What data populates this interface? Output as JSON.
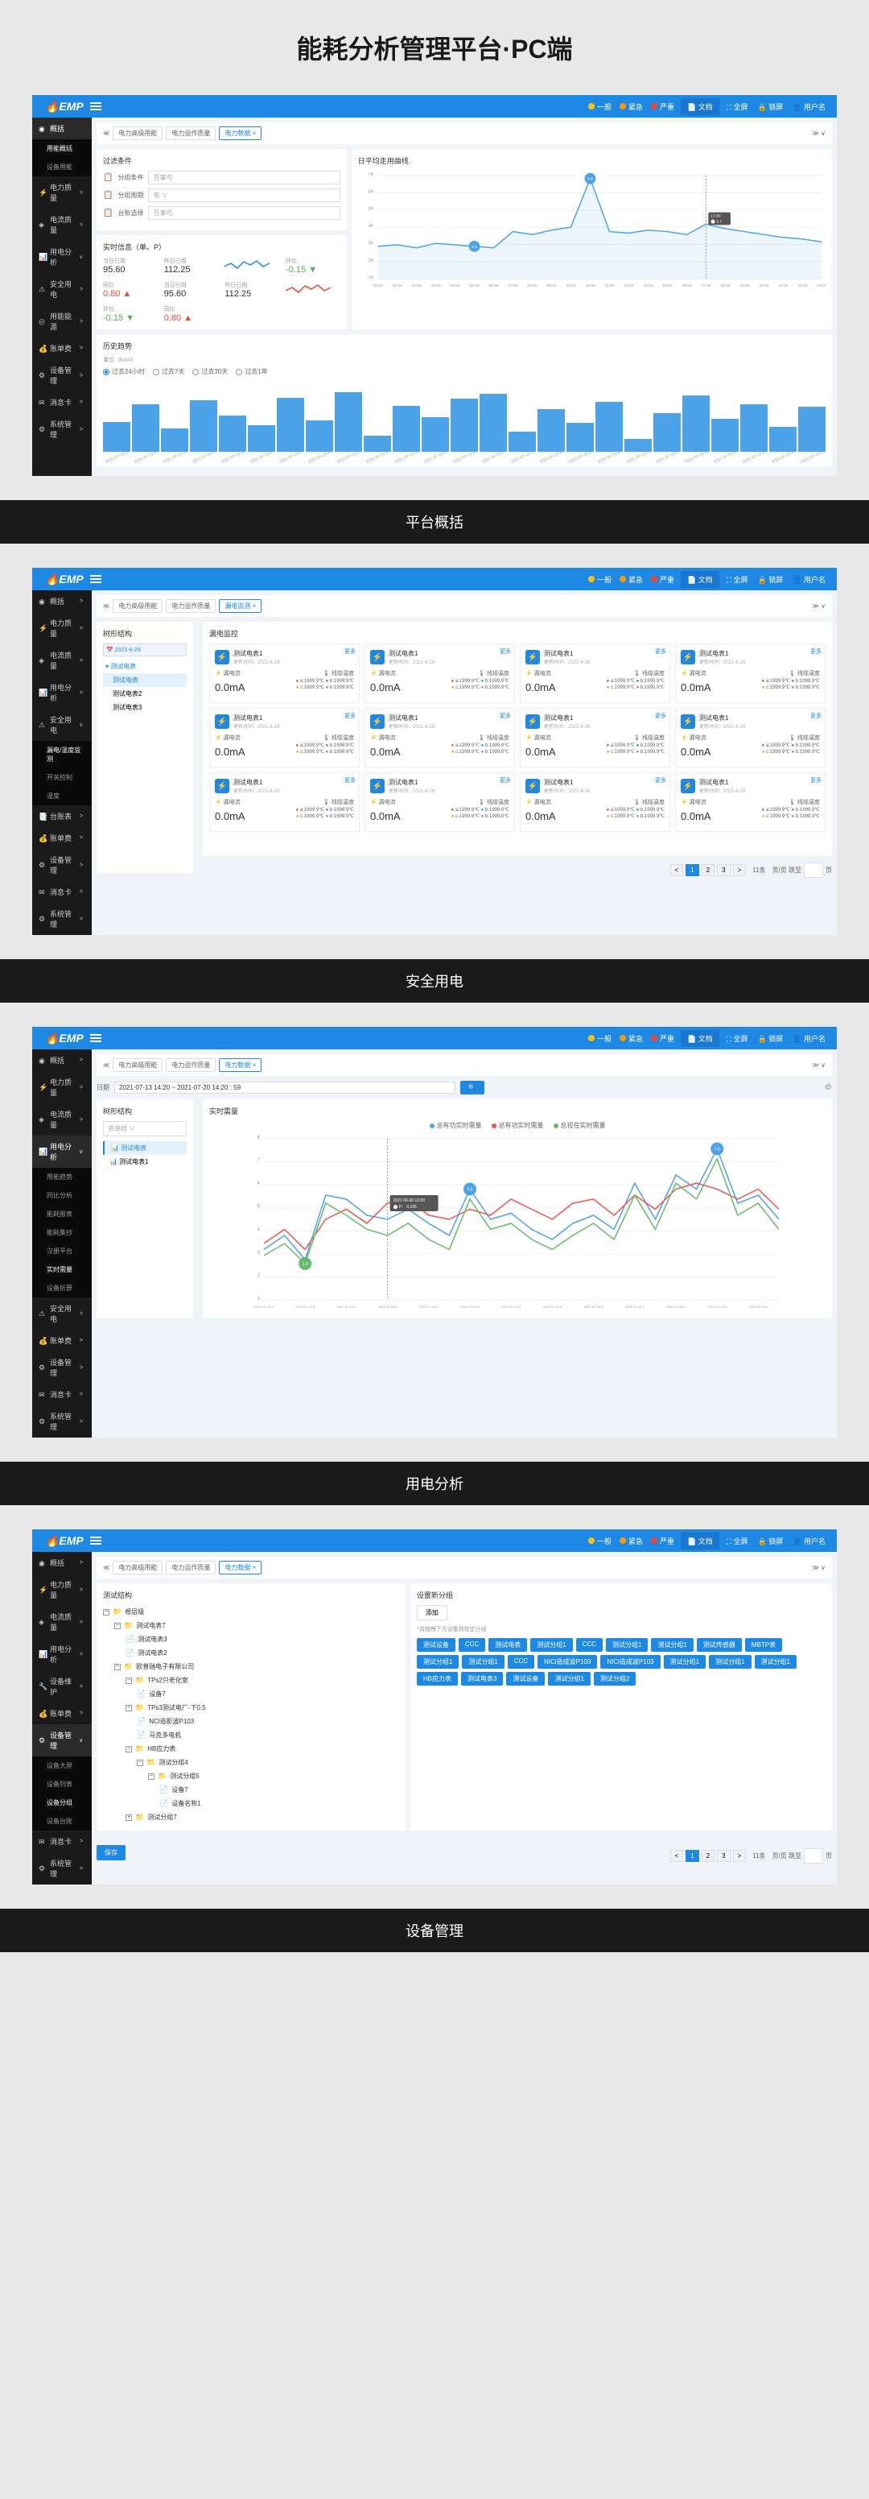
{
  "page_title": "能耗分析管理平台·PC端",
  "logo": "EMP",
  "top_badges": [
    {
      "label": "一般",
      "color": "#ffc107"
    },
    {
      "label": "紧急",
      "color": "#ff9800"
    },
    {
      "label": "严重",
      "color": "#f44336"
    }
  ],
  "top_actions": {
    "doc": "文档",
    "fullscreen": "全屏",
    "lock": "锁屏",
    "user": "用户名"
  },
  "captions": [
    "平台概括",
    "安全用电",
    "用电分析",
    "设备管理"
  ],
  "s1": {
    "sidebar": [
      {
        "label": "概括",
        "icon": "◉",
        "active": true
      },
      {
        "sub": "用能概括",
        "active": true
      },
      {
        "sub": "设备用能"
      },
      {
        "label": "电力质量",
        "icon": "⚡",
        "chev": ">"
      },
      {
        "label": "电流质量",
        "icon": "◈",
        "chev": ">"
      },
      {
        "label": "用电分析",
        "icon": "📊",
        "chev": "v"
      },
      {
        "label": "安全用电",
        "icon": "⚠",
        "chev": ">"
      },
      {
        "label": "用能能源",
        "icon": "◎",
        "chev": ">"
      },
      {
        "label": "账单费",
        "icon": "💰",
        "chev": ">"
      },
      {
        "label": "设备管理",
        "icon": "⚙",
        "chev": ">"
      },
      {
        "label": "消息卡",
        "icon": "✉",
        "chev": ">"
      },
      {
        "label": "系统管理",
        "icon": "⚙",
        "chev": ">"
      }
    ],
    "breadcrumb": {
      "items": [
        "电力高级用能",
        "电力运作质量"
      ],
      "active": "电力数据 ×"
    },
    "filter": {
      "title": "过滤条件",
      "rows": [
        {
          "icon": "📋",
          "label": "分组条件",
          "ph": "百事可"
        },
        {
          "icon": "📋",
          "label": "分组周期",
          "ph": "电",
          "suffix": "∨"
        },
        {
          "icon": "📋",
          "label": "台账选择",
          "ph": "百事可"
        }
      ]
    },
    "realtime": {
      "title": "实时信息（单。P）",
      "stats": [
        {
          "label": "当日已用",
          "value": "95.60"
        },
        {
          "label": "昨日已用",
          "value": "112.25",
          "spark": "blue"
        },
        {
          "label": "环比",
          "value": "-0.15",
          "color": "#4caf50"
        },
        {
          "label": "同比",
          "value": "0.80",
          "color": "#f44336"
        },
        {
          "label": "当日已用",
          "value": "95.60"
        },
        {
          "label": "昨日已用",
          "value": "112.25",
          "spark": "red"
        },
        {
          "label": "环比",
          "value": "-0.15",
          "color": "#4caf50"
        },
        {
          "label": "同比",
          "value": "0.80",
          "color": "#f44336"
        }
      ]
    },
    "chart_data": {
      "line": {
        "type": "line",
        "title": "日平均走用曲线",
        "ylabels": [
          "7K",
          "6K",
          "5K",
          "4K",
          "3K",
          "2K",
          "1K"
        ],
        "x": [
          "00:00",
          "01:00",
          "02:00",
          "03:00",
          "04:00",
          "05:00",
          "06:00",
          "07:00",
          "08:00",
          "09:00",
          "10:00",
          "11:00",
          "12:00",
          "13:00",
          "14:00",
          "15:00",
          "16:00",
          "17:00",
          "18:00",
          "19:00",
          "20:00",
          "21:00",
          "22:00",
          "23:00"
        ],
        "values": [
          2.2,
          2.3,
          2.1,
          2.4,
          2.3,
          2.2,
          2.1,
          3.2,
          3.0,
          3.3,
          3.5,
          6.8,
          3.2,
          3.1,
          3.3,
          3.2,
          3.0,
          3.7,
          3.4,
          3.2,
          3.0,
          2.8,
          2.7,
          2.5
        ],
        "marker1": {
          "idx": 5,
          "val": "2.2"
        },
        "marker2": {
          "idx": 11,
          "val": "6.8"
        },
        "tooltip": {
          "idx": 17,
          "time": "17:30",
          "val": "3.7"
        }
      },
      "bars": {
        "type": "bar",
        "title": "历史趋势",
        "unit": "单位（Kw=）",
        "radios": [
          "过去24小时",
          "过去7天",
          "过去30天",
          "过去1年"
        ],
        "radio_active": 0,
        "x": [
          "2021-07-15 #",
          "2021-07-15 #",
          "2021-07-15 #",
          "2021-07-15 #",
          "2021-07-15 #",
          "2021-07-15 #",
          "2021-07-15 #",
          "2021-07-15 #",
          "2021-07-15 #",
          "2021-07-15 #",
          "2021-07-15 #",
          "2021-07-15 #",
          "2021-07-15 #",
          "2021-07-15 #",
          "2021-07-15 #",
          "2021-07-15 #",
          "2021-07-15 #",
          "2021-07-15 #",
          "2021-07-15 #",
          "2021-07-15 #",
          "2021-07-15 #",
          "2021-07-15 #",
          "2021-07-15 #",
          "2021-07-15 #",
          "2021-07-15 #"
        ],
        "values": [
          45,
          72,
          35,
          78,
          55,
          40,
          82,
          48,
          90,
          24,
          70,
          52,
          80,
          88,
          30,
          65,
          44,
          76,
          20,
          58,
          85,
          50,
          72,
          38,
          68
        ]
      }
    }
  },
  "s2": {
    "sidebar": [
      {
        "label": "概括",
        "icon": "◉",
        "chev": ">"
      },
      {
        "label": "电力质量",
        "icon": "⚡",
        "chev": ">"
      },
      {
        "label": "电流质量",
        "icon": "◈",
        "chev": ">"
      },
      {
        "label": "用电分析",
        "icon": "📊",
        "chev": ">"
      },
      {
        "label": "安全用电",
        "icon": "⚠",
        "chev": "v"
      },
      {
        "sub": "漏电/温度监测",
        "active": true
      },
      {
        "sub": "开关控制"
      },
      {
        "sub": "温度"
      },
      {
        "label": "台账表",
        "icon": "📑",
        "chev": ">"
      },
      {
        "label": "账单费",
        "icon": "💰",
        "chev": ">"
      },
      {
        "label": "设备管理",
        "icon": "⚙",
        "chev": ">"
      },
      {
        "label": "消息卡",
        "icon": "✉",
        "chev": ">"
      },
      {
        "label": "系统管理",
        "icon": "⚙",
        "chev": ">"
      }
    ],
    "breadcrumb": {
      "items": [
        "电力高级用能",
        "电力运作质量"
      ],
      "active": "漏电监测 ×"
    },
    "left_title": "树形结构",
    "left_date": "2021-6-29",
    "left_tree": [
      "测试电表",
      "测试电表2",
      "测试电表3"
    ],
    "main_title": "漏电监控",
    "card": {
      "name": "测试电表1",
      "sub": "更新时间：2021-6-29",
      "more": "更多",
      "col1": "漏电流",
      "col2": "线缆温度",
      "value": "0.0mA",
      "temps": [
        "a:1999.9℃",
        "b:1999.9℃",
        "c:1999.9℃",
        "b:1999.9℃"
      ]
    },
    "card_count": 12,
    "pagination": {
      "pages": [
        "<",
        "1",
        "2",
        "3",
        ">"
      ],
      "active": 1,
      "total": "11条",
      "jump": "页/页 跳至",
      "suffix": "页"
    }
  },
  "s3": {
    "sidebar": [
      {
        "label": "概括",
        "icon": "◉",
        "chev": ">"
      },
      {
        "label": "电力质量",
        "icon": "⚡",
        "chev": ">"
      },
      {
        "label": "电流质量",
        "icon": "◈",
        "chev": ">"
      },
      {
        "label": "用电分析",
        "icon": "📊",
        "chev": "v",
        "active": true
      },
      {
        "sub": "用能趋势"
      },
      {
        "sub": "同比分析"
      },
      {
        "sub": "能耗报表"
      },
      {
        "sub": "能耗集抄"
      },
      {
        "sub": "汉册平台"
      },
      {
        "sub": "实时需量",
        "active": true
      },
      {
        "sub": "设备折算"
      },
      {
        "label": "安全用电",
        "icon": "⚠",
        "chev": ">"
      },
      {
        "label": "账单费",
        "icon": "💰",
        "chev": ">"
      },
      {
        "label": "设备管理",
        "icon": "⚙",
        "chev": ">"
      },
      {
        "label": "消息卡",
        "icon": "✉",
        "chev": ">"
      },
      {
        "label": "系统管理",
        "icon": "⚙",
        "chev": ">"
      }
    ],
    "breadcrumb": {
      "items": [
        "电力高级用能",
        "电力运作质量"
      ],
      "active": "电力数据 ×"
    },
    "left_title": "树形结构",
    "left_root": "资源组",
    "left_items": [
      "测试电表",
      "测试电表1"
    ],
    "date_label": "日期",
    "date_value": "2021-07-13 14:20 ~ 2021-07-20 14:20 : 59",
    "chart_title": "实时需量",
    "chart_data": {
      "type": "line",
      "legend": [
        {
          "name": "总有功实时需量",
          "color": "#4da3e8"
        },
        {
          "name": "总有功实时需量",
          "color": "#ef5350"
        },
        {
          "name": "总视在实时需量",
          "color": "#66bb6a"
        }
      ],
      "x": [
        "2021-07-13 #",
        "2021-07-13 #",
        "2021-07-13 #",
        "2021-07-14 #",
        "2021-07-14 #",
        "2021-07-14 #",
        "2021-07-14 #",
        "2021-07-14 #",
        "2021-07-14 #",
        "2021-07-14 #",
        "2021-07-14 #",
        "2021-07-14 #",
        "2021-07-14 #",
        "2021-07-14 #",
        "2021-07-14 #",
        "2021-07-15 #",
        "2021-07-15 #",
        "2021-07-15 #",
        "2021-07-15 #",
        "2021-07-15 #",
        "2021-07-15 #",
        "2021-07-15 #",
        "2021-07-15 #",
        "2021-07-15 #",
        "2021-07-15 #",
        "2021-07-15 #"
      ],
      "ylabels": [
        "8",
        "7",
        "6",
        "5",
        "4",
        "3",
        "2",
        "1"
      ],
      "series": [
        {
          "values": [
            2.5,
            3.2,
            2.0,
            5.2,
            5.0,
            4.2,
            4.0,
            4.5,
            3.8,
            3.2,
            5.5,
            4.0,
            4.3,
            3.5,
            3.0,
            3.8,
            4.2,
            3.5,
            5.8,
            4.0,
            6.2,
            5.5,
            7.5,
            4.8,
            5.2,
            4.0
          ]
        },
        {
          "values": [
            2.8,
            3.5,
            2.5,
            4.0,
            4.5,
            3.8,
            4.8,
            5.0,
            4.2,
            4.0,
            4.5,
            4.2,
            5.0,
            4.5,
            4.0,
            4.8,
            5.0,
            4.2,
            5.2,
            4.5,
            5.5,
            5.8,
            5.5,
            5.0,
            5.5,
            4.5
          ]
        },
        {
          "values": [
            2.2,
            2.8,
            1.8,
            4.8,
            4.2,
            3.5,
            3.2,
            3.8,
            3.0,
            2.5,
            5.0,
            3.5,
            3.8,
            3.0,
            2.5,
            3.2,
            3.8,
            3.0,
            5.2,
            3.5,
            5.8,
            5.0,
            7.0,
            4.2,
            4.8,
            3.5
          ]
        }
      ],
      "markers": [
        {
          "idx": 2,
          "val": "1.8",
          "series": 2
        },
        {
          "idx": 10,
          "val": "5.5",
          "series": 0
        },
        {
          "idx": 22,
          "val": "7.5",
          "series": 0
        }
      ],
      "tooltip": {
        "idx": 6,
        "time": "2021-06-30 12:00",
        "val": "P： 0.195"
      }
    }
  },
  "s4": {
    "sidebar": [
      {
        "label": "概括",
        "icon": "◉",
        "chev": ">"
      },
      {
        "label": "电力质量",
        "icon": "⚡",
        "chev": ">"
      },
      {
        "label": "电流质量",
        "icon": "◈",
        "chev": ">"
      },
      {
        "label": "用电分析",
        "icon": "📊",
        "chev": ">"
      },
      {
        "label": "设备维护",
        "icon": "🔧",
        "chev": ">"
      },
      {
        "label": "账单费",
        "icon": "💰",
        "chev": ">"
      },
      {
        "label": "设备管理",
        "icon": "⚙",
        "chev": "v",
        "active": true
      },
      {
        "sub": "设备大屏"
      },
      {
        "sub": "设备列表"
      },
      {
        "sub": "设备分组",
        "active": true
      },
      {
        "sub": "设备台账"
      },
      {
        "label": "消息卡",
        "icon": "✉",
        "chev": ">"
      },
      {
        "label": "系统管理",
        "icon": "⚙",
        "chev": ">"
      }
    ],
    "breadcrumb": {
      "items": [
        "电力高级用能",
        "电力运作质量"
      ],
      "active": "电力数据 ×"
    },
    "left_title": "测试结构",
    "right_title": "设置新分组",
    "add_btn": "添加",
    "hint": "*请拖拽下方设备到指定分组",
    "tags": [
      "测试设备",
      "CCC",
      "测试电表",
      "测试分组1",
      "CCC",
      "测试分组1",
      "测试分组1",
      "测试传感器",
      "MBTP表",
      "测试分组1",
      "测试分组1",
      "CCC",
      "NICl造成波P103",
      "NICl造成波P103",
      "测试分组1",
      "测试分组1",
      "测试分组1",
      "HB应力表",
      "测试电表3",
      "测试设备",
      "测试分组1",
      "测试分组2"
    ],
    "tree": [
      {
        "indent": 0,
        "type": "folder",
        "label": "根层级",
        "toggle": "−"
      },
      {
        "indent": 1,
        "type": "folder",
        "label": "测试电表7",
        "toggle": "−"
      },
      {
        "indent": 2,
        "type": "file",
        "label": "测试电表3"
      },
      {
        "indent": 2,
        "type": "file",
        "label": "测试电表2"
      },
      {
        "indent": 1,
        "type": "folder",
        "label": "欧普瑞电子有限公司",
        "toggle": "−"
      },
      {
        "indent": 2,
        "type": "folder",
        "label": "TPs2只老化室",
        "toggle": "−"
      },
      {
        "indent": 3,
        "type": "file",
        "label": "设备7"
      },
      {
        "indent": 2,
        "type": "folder",
        "label": "TPs3测试电厂-下0.5",
        "toggle": "−"
      },
      {
        "indent": 3,
        "type": "file",
        "label": "NCl造影波P103"
      },
      {
        "indent": 3,
        "type": "file",
        "label": "马克多电机"
      },
      {
        "indent": 2,
        "type": "folder",
        "label": "HB应力表",
        "toggle": "−"
      },
      {
        "indent": 3,
        "type": "folder",
        "label": "测试分组4",
        "toggle": "−"
      },
      {
        "indent": 4,
        "type": "folder",
        "label": "测试分组5",
        "toggle": "−"
      },
      {
        "indent": 5,
        "type": "file",
        "label": "设备7"
      },
      {
        "indent": 5,
        "type": "file",
        "label": "设备名称1"
      },
      {
        "indent": 2,
        "type": "folder",
        "label": "测试分组7",
        "toggle": "+"
      }
    ],
    "save_btn": "保存",
    "pagination": {
      "pages": [
        "<",
        "1",
        "2",
        "3",
        ">"
      ],
      "active": 1,
      "total": "11条",
      "jump": "页/页 跳至",
      "suffix": "页"
    }
  }
}
